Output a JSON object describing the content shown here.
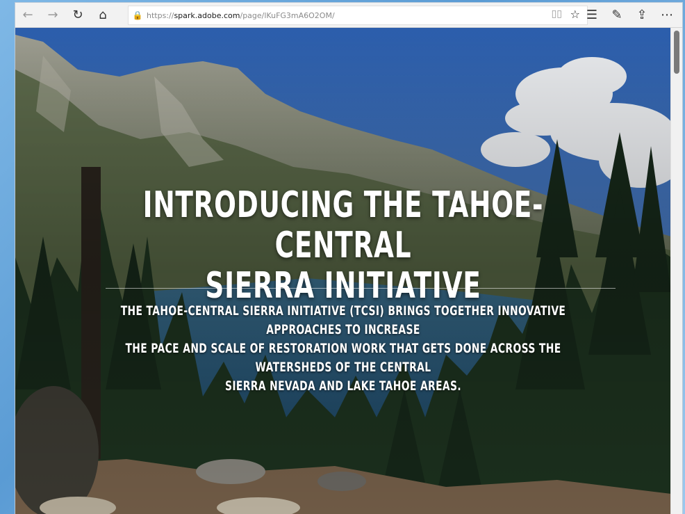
{
  "browser": {
    "url_scheme": "https://",
    "url_host": "spark.adobe.com",
    "url_path": "/page/lKuFG3mA6O2OM/",
    "icons": {
      "back": "←",
      "forward": "→",
      "refresh": "↻",
      "home": "⌂",
      "lock": "🔒",
      "reading_view": "▯▯",
      "favorite": "☆",
      "favorites_hub": "☰",
      "notes": "✎",
      "share": "⇪",
      "more": "⋯"
    }
  },
  "page": {
    "title_line1": "INTRODUCING THE TAHOE-CENTRAL",
    "title_line2": "SIERRA INITIATIVE",
    "subtitle_line1": "THE TAHOE-CENTRAL SIERRA INITIATIVE (TCSI) BRINGS TOGETHER INNOVATIVE APPROACHES TO INCREASE",
    "subtitle_line2": "THE PACE AND SCALE OF RESTORATION WORK THAT GETS DONE ACROSS THE WATERSHEDS OF THE CENTRAL",
    "subtitle_line3": "SIERRA NEVADA AND LAKE TAHOE AREAS."
  },
  "colors": {
    "sky": "#3f78c4",
    "cloud": "#f4f6f8",
    "mountain": "#8b8c80",
    "forest": "#1f3322",
    "lake": "#255a7d",
    "ground": "#8a7057"
  }
}
